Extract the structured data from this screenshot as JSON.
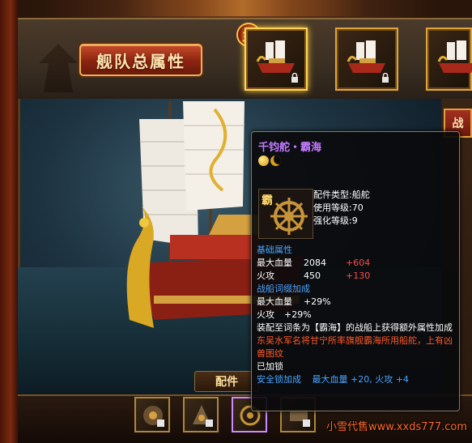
{
  "fleet_button_label": "舰队总属性",
  "crown_badge": "主",
  "right_tab_label": "战",
  "parts_label": "配件",
  "watermark": "小雪代售www.xxds777.com",
  "tooltip": {
    "title": "千钧舵・霸海",
    "icon_char": "霸",
    "type_label": "配件类型:",
    "type_value": "船舵",
    "level_label": "使用等级:",
    "level_value": "70",
    "enhance_label": "强化等级:",
    "enhance_value": "9",
    "base_header": "基础属性",
    "base_stats": [
      {
        "name": "最大血量",
        "value": "2084",
        "bonus": "+604"
      },
      {
        "name": "火攻",
        "value": "450",
        "bonus": "+130"
      }
    ],
    "affix_header": "战船词缀加成",
    "affix_stats": [
      {
        "name": "最大血量",
        "value": "+29%"
      },
      {
        "name": "火攻",
        "value": "+29%"
      }
    ],
    "affix_note": "装配至词条为【霸海】的战船上获得额外属性加成",
    "lore": "东吴水军名将甘宁所率旗舰霸海所用船舵，上有凶兽图纹",
    "lock_status": "已加锁",
    "safe_lock_label": "安全锁加成",
    "safe_lock_bonus": "最大血量 +20, 火攻 +4"
  },
  "colors": {
    "title": "#c27aff",
    "section": "#4aa6ff",
    "bonus": "#ff4a4a",
    "lore": "#ff5a2a",
    "watermark": "#ff6a2a"
  }
}
